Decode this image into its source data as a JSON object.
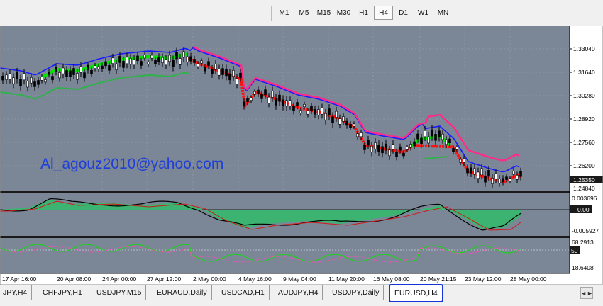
{
  "toolbar": {
    "timeframes": [
      {
        "label": "M1",
        "active": false
      },
      {
        "label": "M5",
        "active": false
      },
      {
        "label": "M15",
        "active": false
      },
      {
        "label": "M30",
        "active": false
      },
      {
        "label": "H1",
        "active": false
      },
      {
        "label": "H4",
        "active": true
      },
      {
        "label": "D1",
        "active": false
      },
      {
        "label": "W1",
        "active": false
      },
      {
        "label": "MN",
        "active": false
      }
    ]
  },
  "chart": {
    "watermark": "Al_agouz2010@yahoo.com",
    "price_scale": [
      "1.33040",
      "1.31640",
      "1.30280",
      "1.28920",
      "1.27560",
      "1.26200",
      "1.24840"
    ],
    "current_price": "1.25350",
    "macd_scale": [
      "0.003696",
      "0.00",
      "-0.005927"
    ],
    "rsi_scale": [
      "68.2913",
      "50",
      "18.6408"
    ],
    "time_labels": [
      "17 Apr 16:00",
      "20 Apr 08:00",
      "24 Apr 00:00",
      "27 Apr 12:00",
      "2 May 00:00",
      "4 May 16:00",
      "9 May 04:00",
      "11 May 20:00",
      "16 May 08:00",
      "20 May 21:15",
      "23 May 12:00",
      "28 May 00:00"
    ],
    "colors": {
      "background": "#7b8696",
      "bull_band": "#00e600",
      "bear_band": "#ff1010",
      "upper_line": "#1a1aff",
      "pink_line": "#ff2a8a",
      "lower_line": "#2db34a",
      "macd_hist": "#3cb371",
      "watermark": "#1f3fd8"
    }
  },
  "tabs": [
    {
      "label": "JPY,H4",
      "active": false
    },
    {
      "label": "CHFJPY,H1",
      "active": false
    },
    {
      "label": "USDJPY,M15",
      "active": false
    },
    {
      "label": "EURAUD,Daily",
      "active": false
    },
    {
      "label": "USDCAD,H1",
      "active": false
    },
    {
      "label": "AUDJPY,H4",
      "active": false
    },
    {
      "label": "USDJPY,Daily",
      "active": false
    },
    {
      "label": "EURUSD,H4",
      "active": true
    }
  ],
  "scroll_button": "◄►"
}
